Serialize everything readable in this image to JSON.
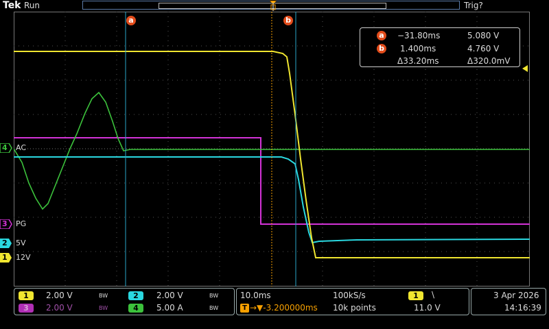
{
  "header": {
    "brand": "Tek",
    "run_state": "Run",
    "trigger_status": "Trig?"
  },
  "colors": {
    "ch1": "#f0e630",
    "ch2": "#2ad8e0",
    "ch3": "#d433d8",
    "ch4": "#3cc23c",
    "cursor": "#e24c1b",
    "trigger": "#f7a000"
  },
  "channel_markers": [
    {
      "num": "4",
      "label": "AC"
    },
    {
      "num": "3",
      "label": "PG"
    },
    {
      "num": "2",
      "label": "5V"
    },
    {
      "num": "1",
      "label": "12V"
    }
  ],
  "cursors": {
    "a_label": "a",
    "b_label": "b",
    "a_time": "−31.80ms",
    "a_value": "5.080 V",
    "b_time": "1.400ms",
    "b_value": "4.760 V",
    "delta_time": "Δ33.20ms",
    "delta_value": "Δ320.0mV"
  },
  "bottom": {
    "ch1_num": "1",
    "ch1_scale": "2.00 V",
    "ch1_bw": "BW",
    "ch2_num": "2",
    "ch2_scale": "2.00 V",
    "ch2_bw": "BW",
    "ch3_num": "3",
    "ch3_scale": "2.00 V",
    "ch3_bw": "BW",
    "ch4_num": "4",
    "ch4_scale": "5.00 A",
    "ch4_bw": "BW",
    "timebase": "10.0ms",
    "sample_rate": "100kS/s",
    "trigger_delay": "→▼-3.200000ms",
    "record_length": "10k points",
    "trig_source": "1",
    "trig_slope": "\\",
    "trig_level": "11.0 V",
    "date": "3 Apr  2026",
    "time": "14:16:39"
  }
}
